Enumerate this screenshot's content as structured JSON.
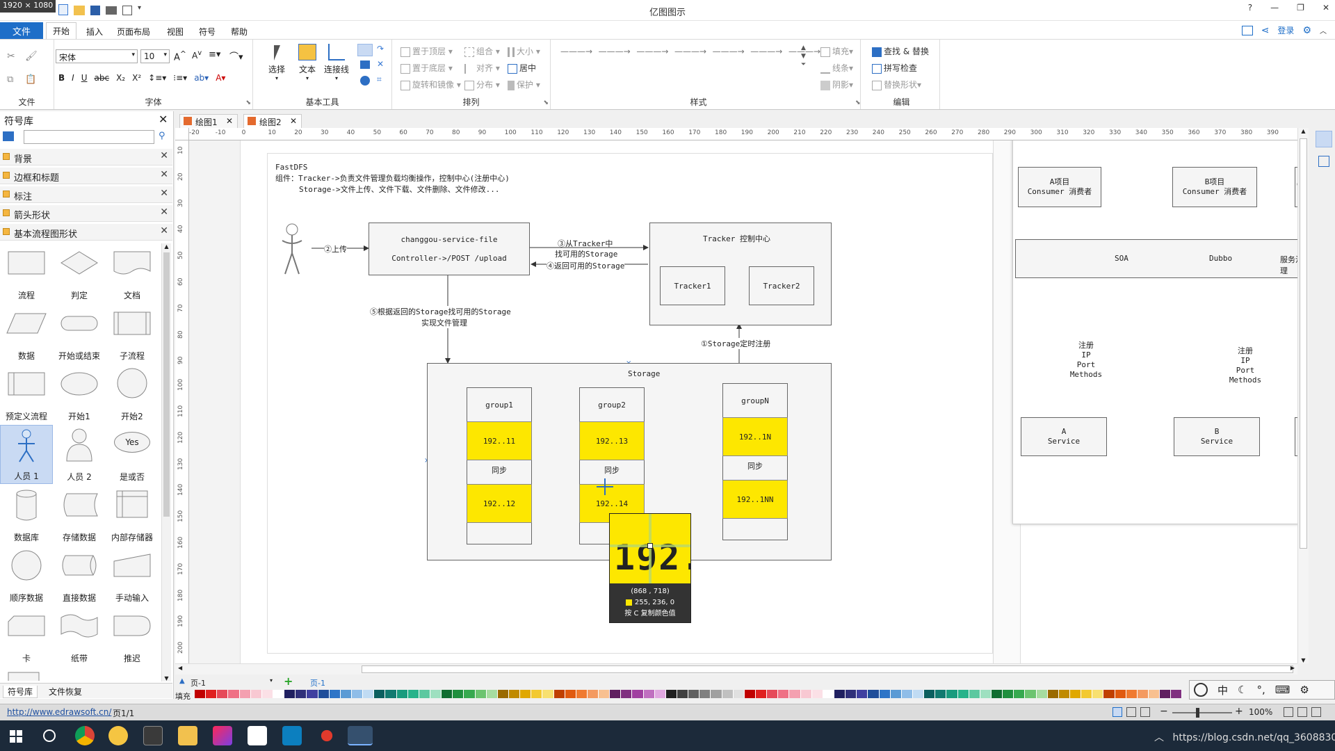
{
  "window": {
    "title": "亿图图示",
    "screen_size_overlay": "1920 × 1080",
    "login": "登录"
  },
  "menu": {
    "file": "文件",
    "tabs": [
      "开始",
      "插入",
      "页面布局",
      "视图",
      "符号",
      "帮助"
    ]
  },
  "ribbon": {
    "groups": {
      "file": "文件",
      "font": "字体",
      "basic_tools": "基本工具",
      "arrange": "排列",
      "style": "样式",
      "edit": "编辑"
    },
    "font_name": "宋体",
    "font_size": "10",
    "tools": {
      "select": "选择",
      "text": "文本",
      "connector": "连接线"
    },
    "arrange": {
      "bring_front": "置于顶层",
      "send_back": "置于底层",
      "rotate": "旋转和镜像",
      "group": "组合",
      "align": "对齐",
      "distribute": "分布",
      "size": "大小",
      "center": "居中",
      "protect": "保护"
    },
    "style": {
      "fill": "填充",
      "line": "线条",
      "shadow": "阴影"
    },
    "edit": {
      "find_replace": "查找 & 替换",
      "spell": "拼写检查",
      "replace_shape": "替换形状"
    }
  },
  "library": {
    "title": "符号库",
    "categories": [
      "背景",
      "边框和标题",
      "标注",
      "箭头形状",
      "基本流程图形状"
    ],
    "shapes": [
      "流程",
      "判定",
      "文档",
      "数据",
      "开始或结束",
      "子流程",
      "预定义流程",
      "开始1",
      "开始2",
      "人员 1",
      "人员 2",
      "是或否",
      "数据库",
      "存储数据",
      "内部存储器",
      "顺序数据",
      "直接数据",
      "手动输入",
      "卡",
      "纸带",
      "推迟"
    ],
    "yes_label": "Yes",
    "bottom_tabs": [
      "符号库",
      "文件恢复"
    ]
  },
  "doc_tabs": [
    "绘图1",
    "绘图2"
  ],
  "ruler": {
    "h_ticks": [
      "-20",
      "-10",
      "0",
      "10",
      "20",
      "30",
      "40",
      "50",
      "60",
      "70",
      "80",
      "90",
      "100",
      "110",
      "120",
      "130",
      "140",
      "150",
      "160",
      "170",
      "180",
      "190",
      "200",
      "210",
      "220",
      "230",
      "240",
      "250",
      "260",
      "270",
      "280",
      "290",
      "300",
      "310",
      "320",
      "330",
      "340",
      "350",
      "360",
      "370",
      "380",
      "390"
    ],
    "v_ticks": [
      "10",
      "20",
      "30",
      "40",
      "50",
      "60",
      "70",
      "80",
      "90",
      "100",
      "110",
      "120",
      "130",
      "140",
      "150",
      "160",
      "170",
      "180",
      "190",
      "200"
    ]
  },
  "diagram": {
    "title": "FastDFS",
    "line1": "组件：Tracker->负责文件管理负载均衡操作，控制中心(注册中心)",
    "line2": "Storage->文件上传、文件下载、文件删除、文件修改...",
    "upload": "②上传",
    "service_line1": "changgou-service-file",
    "service_line2": "Controller->/POST /upload",
    "step3a": "③从Tracker中",
    "step3b": "找可用的Storage",
    "step4": "④返回可用的Storage",
    "step5a": "⑤根据返回的Storage找可用的Storage",
    "step5b": "实现文件管理",
    "step1": "①Storage定时注册",
    "tracker_title": "Tracker  控制中心",
    "tracker1": "Tracker1",
    "tracker2": "Tracker2",
    "storage": "Storage",
    "groups": [
      {
        "name": "group1",
        "ip1": "192..11",
        "sync": "同步",
        "ip2": "192..12"
      },
      {
        "name": "group2",
        "ip1": "192..13",
        "sync": "同步",
        "ip2": "192..14"
      },
      {
        "name": "groupN",
        "ip1": "192..1N",
        "sync": "同步",
        "ip2": "192..1NN"
      }
    ]
  },
  "magnifier": {
    "zoom_text": "192.",
    "coords": "(868 , 718)",
    "rgb": "255, 236,   0",
    "hint": "按 C 复制颜色值"
  },
  "right_diagram": {
    "proj_a_1": "A项目",
    "proj_a_2": "Consumer 消费者",
    "proj_b_1": "B项目",
    "proj_b_2": "Consumer 消费者",
    "soa": "SOA",
    "dubbo": "Dubbo",
    "gov": "服务治理",
    "reg_a": [
      "注册",
      "IP",
      "Port",
      "Methods"
    ],
    "reg_b": [
      "注册",
      "IP",
      "Port",
      "Methods"
    ],
    "svc_a_1": "A",
    "svc_a_2": "Service",
    "svc_b_1": "B",
    "svc_b_2": "Service"
  },
  "pages": {
    "page_select": "页-1",
    "page_tab": "页-1"
  },
  "fill_label": "填充",
  "status": {
    "url": "http://www.edrawsoft.cn/",
    "page": "页1/1",
    "zoom": "100%"
  },
  "ime": {
    "lang": "中"
  },
  "taskbar": {
    "url_fragment": "https://blog.csdn.net/qq_3608830"
  },
  "colors": {
    "accent": "#1e6ec8",
    "highlight": "#fde700",
    "selected_shape": "#c9daf3"
  }
}
